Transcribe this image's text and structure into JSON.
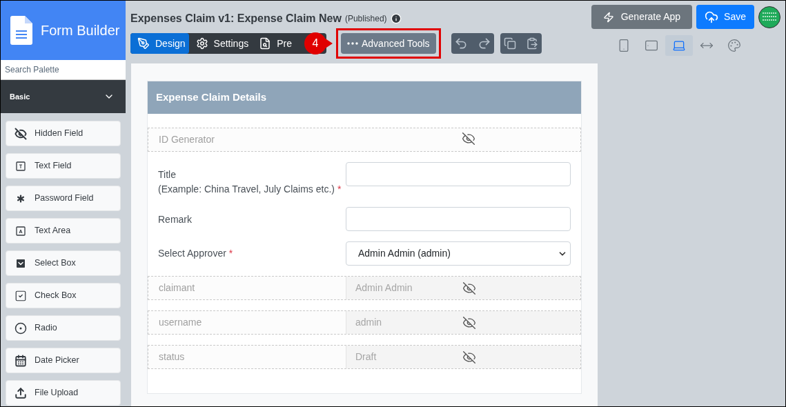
{
  "app": {
    "title": "Form Builder"
  },
  "palette": {
    "search_placeholder": "Search Palette",
    "group": {
      "label": "Basic",
      "expanded": true
    },
    "items": [
      {
        "label": "Hidden Field",
        "kind": "hidden"
      },
      {
        "label": "Text Field",
        "kind": "text"
      },
      {
        "label": "Password Field",
        "kind": "password"
      },
      {
        "label": "Text Area",
        "kind": "textarea"
      },
      {
        "label": "Select Box",
        "kind": "select"
      },
      {
        "label": "Check Box",
        "kind": "checkbox"
      },
      {
        "label": "Radio",
        "kind": "radio"
      },
      {
        "label": "Date Picker",
        "kind": "date"
      },
      {
        "label": "File Upload",
        "kind": "upload"
      }
    ]
  },
  "header": {
    "title": "Expenses Claim v1: Expense Claim New",
    "status": "(Published)",
    "tabs": [
      {
        "label": "Design",
        "kind": "design",
        "selected": true
      },
      {
        "label": "Settings",
        "kind": "settings",
        "selected": false
      },
      {
        "label": "Pre",
        "kind": "preview",
        "selected": false
      }
    ],
    "advanced_tools": "Advanced Tools",
    "callout": {
      "label": "4"
    },
    "view_modes": [
      {
        "kind": "phone",
        "selected": false
      },
      {
        "kind": "tablet",
        "selected": false
      },
      {
        "kind": "laptop",
        "selected": true
      },
      {
        "kind": "wide",
        "selected": false
      },
      {
        "kind": "theme",
        "selected": false
      }
    ],
    "generate_button": "Generate App",
    "save_button": "Save"
  },
  "form": {
    "section_title": "Expense Claim Details",
    "fields": [
      {
        "kind": "hidden",
        "label": "ID Generator"
      },
      {
        "kind": "text",
        "label": "Title",
        "hint": "(Example: China Travel, July Claims etc.)",
        "required_mark": "*"
      },
      {
        "kind": "text",
        "label": "Remark"
      },
      {
        "kind": "select",
        "label": "Select Approver",
        "required_mark": "*",
        "value": "Admin Admin (admin)"
      },
      {
        "kind": "hidden",
        "label": "claimant",
        "value": "Admin Admin"
      },
      {
        "kind": "hidden",
        "label": "username",
        "value": "admin"
      },
      {
        "kind": "hidden",
        "label": "status",
        "value": "Draft"
      }
    ]
  }
}
